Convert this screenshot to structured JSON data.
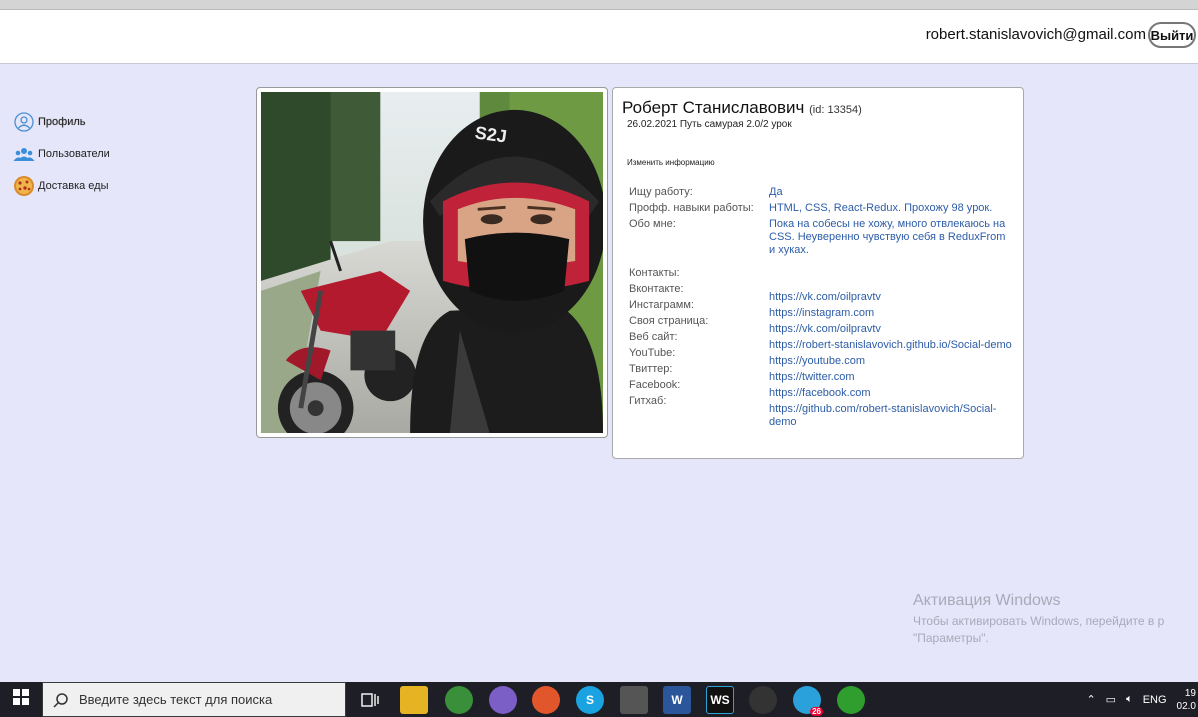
{
  "header": {
    "email": "robert.stanislavovich@gmail.com",
    "logout_label": "Выйти"
  },
  "sidebar": {
    "items": [
      {
        "label": "Профиль",
        "icon": "user-icon"
      },
      {
        "label": "Пользователи",
        "icon": "users-icon"
      },
      {
        "label": "Доставка еды",
        "icon": "pizza-icon"
      }
    ]
  },
  "profile": {
    "name": "Роберт Станиславович",
    "id_text": "(id: 13354)",
    "status": "26.02.2021 Путь самурая 2.0/2 урок",
    "edit_label": "Изменить информацию",
    "fields": [
      {
        "label": "Ищу работу:",
        "value": "Да"
      },
      {
        "label": "Профф. навыки работы:",
        "value": "HTML, CSS, React-Redux. Прохожу 98 урок."
      },
      {
        "label": "Обо мне:",
        "value": "Пока на собесы не хожу, много отвлекаюсь на CSS. Неуверенно чувствую себя в ReduxFrom и хуках."
      }
    ],
    "contact_labels": [
      "Контакты:",
      "Вконтакте:",
      "Инстаграмм:",
      "Своя страница:",
      "Веб сайт:",
      "YouTube:",
      "Твиттер:",
      "Facebook:",
      "Гитхаб:"
    ],
    "contact_links": [
      "https://vk.com/oilpravtv",
      "https://instagram.com",
      "https://vk.com/oilpravtv",
      "https://robert-stanislavovich.github.io/Social-demo",
      "https://youtube.com",
      "https://twitter.com",
      "https://facebook.com",
      "https://github.com/robert-stanislavovich/Social-demo"
    ]
  },
  "watermark": {
    "title": "Активация Windows",
    "line1": "Чтобы активировать Windows, перейдите в р",
    "line2": "\"Параметры\"."
  },
  "taskbar": {
    "search_placeholder": "Введите здесь текст для поиска",
    "lang": "ENG",
    "clock_time": "19",
    "clock_date": "02.0",
    "telegram_badge": "26"
  },
  "colors": {
    "page_bg": "#e6e6fa",
    "link": "#2d5da8",
    "taskbar": "#1e1e26"
  }
}
